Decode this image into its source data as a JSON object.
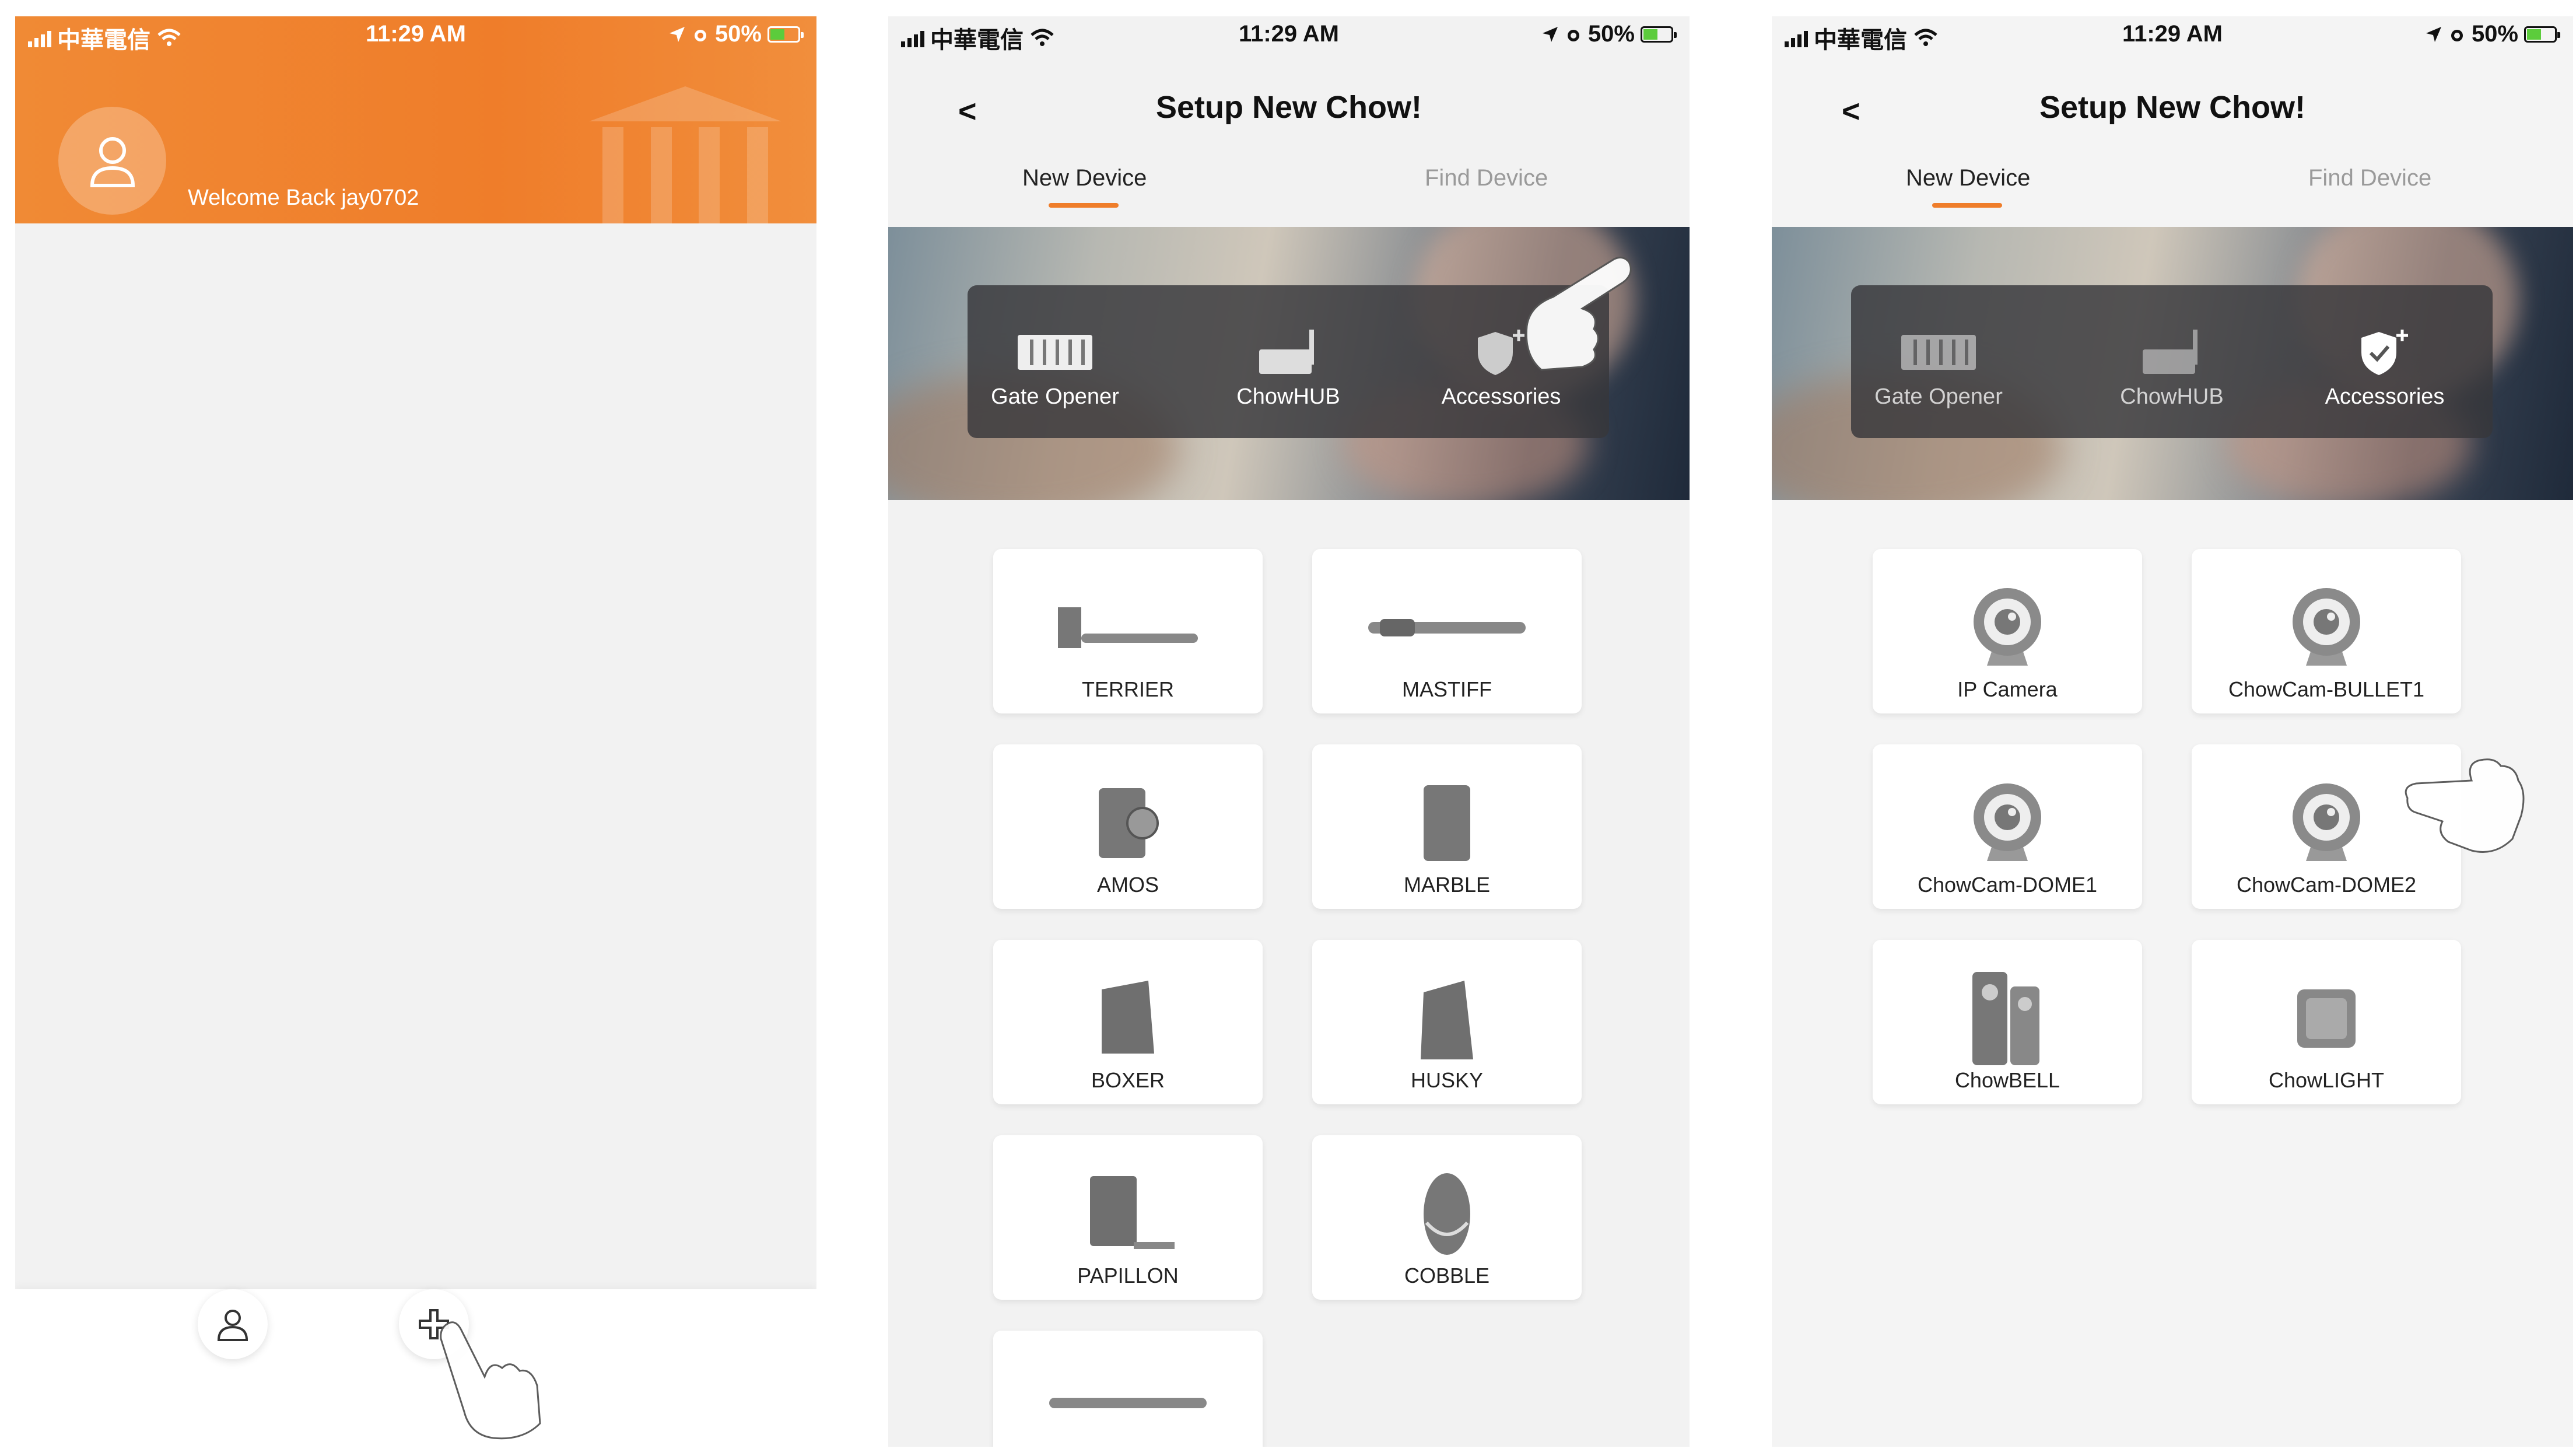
{
  "status_bar": {
    "carrier": "中華電信",
    "time": "11:29 AM",
    "battery": "50%"
  },
  "screen1": {
    "welcome": "Welcome Back jay0702"
  },
  "setup": {
    "back_symbol": "<",
    "title": "Setup New Chow!",
    "tabs": {
      "new_device": "New Device",
      "find_device": "Find Device"
    },
    "categories": [
      "Gate Opener",
      "ChowHUB",
      "Accessories"
    ]
  },
  "screen2": {
    "devices": [
      "TERRIER",
      "MASTIFF",
      "AMOS",
      "MARBLE",
      "BOXER",
      "HUSKY",
      "PAPILLON",
      "COBBLE"
    ]
  },
  "screen3": {
    "devices": [
      "IP Camera",
      "ChowCam-BULLET1",
      "ChowCam-DOME1",
      "ChowCam-DOME2",
      "ChowBELL",
      "ChowLIGHT"
    ]
  },
  "icons": {
    "signal": "signal-bars-icon",
    "wifi": "wifi-icon",
    "location": "location-arrow-icon",
    "alarm": "alarm-icon",
    "battery": "battery-charging-icon",
    "user": "user-icon",
    "add": "plus-icon",
    "pointer": "pointing-hand-icon",
    "gate": "gate-opener-icon",
    "hub": "chowhub-icon",
    "shield": "shield-plus-icon",
    "camera": "camera-icon"
  },
  "colors": {
    "accent": "#EF7D2A",
    "text": "#222222",
    "muted": "#9A9A9A",
    "background": "#F2F2F2"
  }
}
